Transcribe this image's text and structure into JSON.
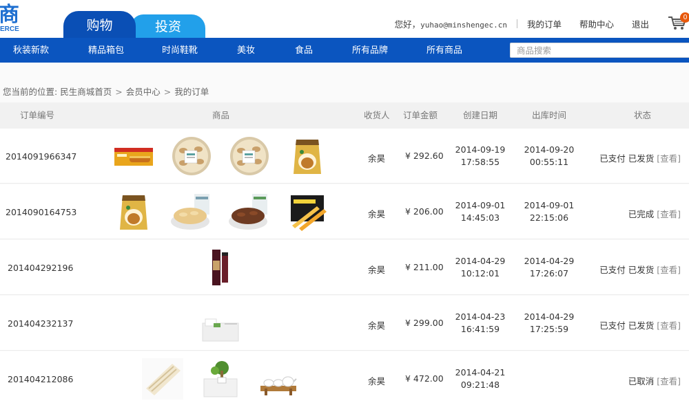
{
  "header": {
    "logo_char": "商",
    "logo_sub": "ERCE",
    "tabs": {
      "shop": "购物",
      "invest": "投资"
    },
    "greeting_prefix": "您好，",
    "email": "yuhao@minshengec.cn",
    "links": {
      "orders": "我的订单",
      "help": "帮助中心",
      "logout": "退出"
    },
    "cart_count": "0"
  },
  "nav": {
    "items": [
      "秋装新款",
      "精品箱包",
      "时尚鞋靴",
      "美妆",
      "食品",
      "所有品牌",
      "所有商品"
    ],
    "search_placeholder": "商品搜索"
  },
  "breadcrumb": {
    "prefix": "您当前的位置:",
    "items": [
      "民生商城首页",
      "会员中心",
      "我的订单"
    ]
  },
  "table": {
    "headers": {
      "order_no": "订单编号",
      "goods": "商品",
      "receiver": "收货人",
      "amount": "订单金额",
      "created": "创建日期",
      "shipped": "出库时间",
      "status": "状态"
    },
    "view_label": "[查看]",
    "rows": [
      {
        "order_no": "2014091966347",
        "products": [
          "wafer-box",
          "nut-tin",
          "nut-tin",
          "snack-bag"
        ],
        "receiver": "余昊",
        "amount": "¥ 292.60",
        "created_date": "2014-09-19",
        "created_time": "17:58:55",
        "shipped_date": "2014-09-20",
        "shipped_time": "00:55:11",
        "status": "已支付 已发货"
      },
      {
        "order_no": "2014090164753",
        "products": [
          "snack-bag",
          "cashew-bowl",
          "pecan-bowl",
          "mango-pack"
        ],
        "receiver": "余昊",
        "amount": "¥ 206.00",
        "created_date": "2014-09-01",
        "created_time": "14:45:03",
        "shipped_date": "2014-09-01",
        "shipped_time": "22:15:06",
        "status": "已完成"
      },
      {
        "order_no": "201404292196",
        "products": [
          "cosmetic-bottle"
        ],
        "receiver": "余昊",
        "amount": "¥ 211.00",
        "created_date": "2014-04-29",
        "created_time": "10:12:01",
        "shipped_date": "2014-04-29",
        "shipped_time": "17:26:07",
        "status": "已支付 已发货"
      },
      {
        "order_no": "201404232137",
        "products": [
          "white-box-set"
        ],
        "receiver": "余昊",
        "amount": "¥ 299.00",
        "created_date": "2014-04-23",
        "created_time": "16:41:59",
        "shipped_date": "2014-04-29",
        "shipped_time": "17:25:59",
        "status": "已支付 已发货"
      },
      {
        "order_no": "201404212086",
        "products": [
          "bamboo-mat",
          "plant-pot",
          "tea-set"
        ],
        "receiver": "余昊",
        "amount": "¥ 472.00",
        "created_date": "2014-04-21",
        "created_time": "09:21:48",
        "shipped_date": "",
        "shipped_time": "",
        "status": "已取消"
      }
    ]
  },
  "colors": {
    "brand_blue": "#0b55bf",
    "tab_active": "#0a4fb5",
    "tab_invest": "#22a0ea",
    "cart_badge": "#e8590c"
  }
}
